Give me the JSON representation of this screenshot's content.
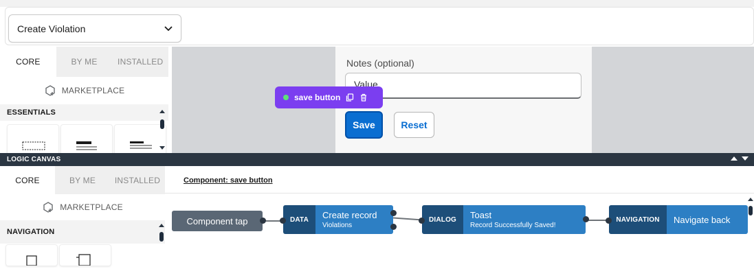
{
  "page_selector": {
    "value": "Create Violation"
  },
  "ui_panel": {
    "tabs": [
      "CORE",
      "BY ME",
      "INSTALLED"
    ],
    "marketplace": "MARKETPLACE",
    "section": "ESSENTIALS"
  },
  "form": {
    "notes_label": "Notes (optional)",
    "notes_value": "Value",
    "save_label": "Save",
    "reset_label": "Reset"
  },
  "selection": {
    "label": "save button"
  },
  "logic_canvas": {
    "header": "LOGIC CANVAS",
    "tabs": [
      "CORE",
      "BY ME",
      "INSTALLED"
    ],
    "marketplace": "MARKETPLACE",
    "section": "NAVIGATION",
    "component_link": "Component: save button",
    "nodes": {
      "trigger": {
        "title": "Component tap"
      },
      "data": {
        "tag": "DATA",
        "title": "Create record",
        "subtitle": "Violations"
      },
      "dialog": {
        "tag": "DIALOG",
        "title": "Toast",
        "subtitle": "Record Successfully Saved!"
      },
      "navigation": {
        "tag": "NAVIGATION",
        "title": "Navigate back"
      }
    }
  },
  "colors": {
    "accent": "#0a6ed1",
    "selection": "#7b3ef0",
    "node_tag": "#1d4e79",
    "node_body": "#2d7fc4",
    "header_dark": "#2b3642"
  }
}
